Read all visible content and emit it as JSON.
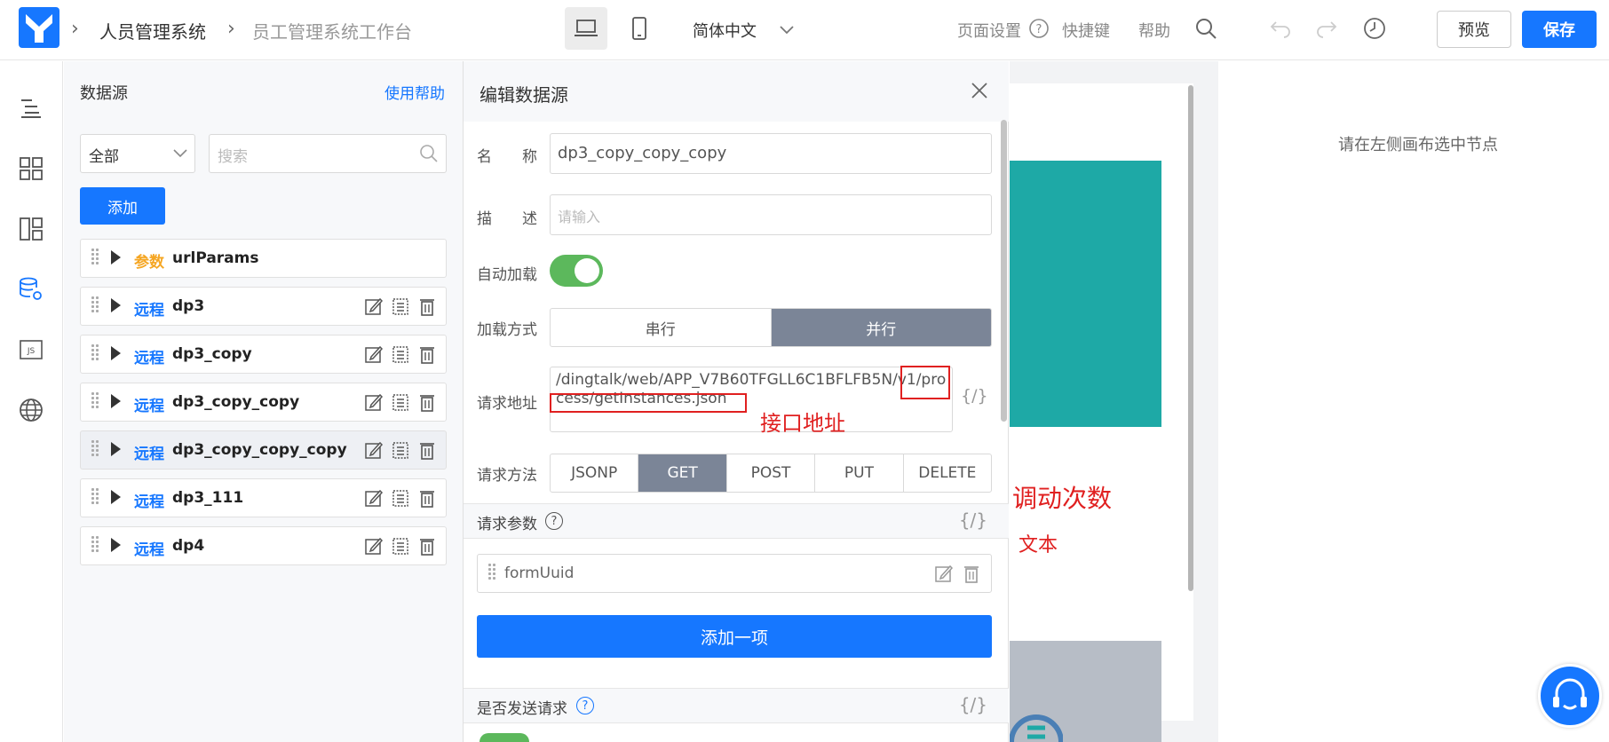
{
  "header": {
    "breadcrumb_app": "人员管理系统",
    "breadcrumb_page": "员工管理系统工作台",
    "language": "简体中文",
    "page_settings": "页面设置",
    "shortcuts": "快捷键",
    "help": "帮助",
    "preview_label": "预览",
    "save_label": "保存"
  },
  "datasource_panel": {
    "title": "数据源",
    "help_link": "使用帮助",
    "filter_value": "全部",
    "search_placeholder": "搜索",
    "add_label": "添加",
    "items": [
      {
        "tag": "参数",
        "name": "urlParams",
        "tag_color": "#f5a623"
      },
      {
        "tag": "远程",
        "name": "dp3",
        "tag_color": "#1677ff"
      },
      {
        "tag": "远程",
        "name": "dp3_copy",
        "tag_color": "#1677ff"
      },
      {
        "tag": "远程",
        "name": "dp3_copy_copy",
        "tag_color": "#1677ff"
      },
      {
        "tag": "远程",
        "name": "dp3_copy_copy_copy",
        "tag_color": "#1677ff"
      },
      {
        "tag": "远程",
        "name": "dp3_111",
        "tag_color": "#1677ff"
      },
      {
        "tag": "远程",
        "name": "dp4",
        "tag_color": "#1677ff"
      }
    ]
  },
  "edit_panel": {
    "title": "编辑数据源",
    "name_label": "名　　称",
    "name_value": "dp3_copy_copy_copy",
    "desc_label": "描　　述",
    "desc_placeholder": "请输入",
    "autoload_label": "自动加载",
    "load_mode_label": "加载方式",
    "load_modes": [
      "串行",
      "并行"
    ],
    "url_label": "请求地址",
    "url_value": "/dingtalk/web/APP_V7B60TFGLL6C1BFLFB5N/v1/process/getInstances.json",
    "url_annotation": "接口地址",
    "method_label": "请求方法",
    "methods": [
      "JSONP",
      "GET",
      "POST",
      "PUT",
      "DELETE"
    ],
    "params_label": "请求参数",
    "param_item": "formUuid",
    "add_item_label": "添加一项",
    "send_label": "是否发送请求",
    "braces": "{/}"
  },
  "canvas": {
    "annotation_calls": "调动次数",
    "annotation_text": "文本"
  },
  "props_panel": {
    "hint": "请在左侧画布选中节点"
  },
  "colors": {
    "primary": "#1677ff",
    "active_segment": "#7b8597",
    "toggle_on": "#5cb85c",
    "annotation": "#e02020",
    "teal": "#1ea9a6"
  }
}
